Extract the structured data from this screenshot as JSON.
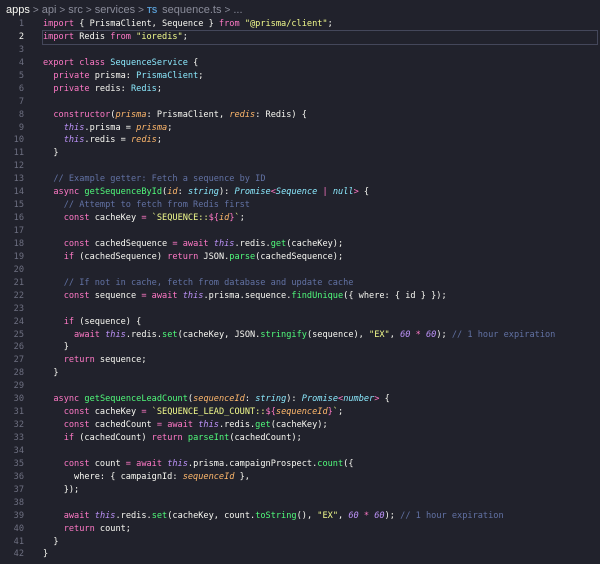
{
  "breadcrumb": {
    "items": [
      "apps",
      "api",
      "src",
      "services"
    ],
    "file_badge": "TS",
    "file": "sequence.ts",
    "more": "..."
  },
  "editor": {
    "active_line": 2,
    "lines": [
      [
        [
          "k",
          "import"
        ],
        [
          "x",
          " { PrismaClient, Sequence } "
        ],
        [
          "k",
          "from"
        ],
        [
          "x",
          " "
        ],
        [
          "s",
          "\"@prisma/client\""
        ],
        [
          "x",
          ";"
        ]
      ],
      [
        [
          "k",
          "import"
        ],
        [
          "x",
          " Redis "
        ],
        [
          "k",
          "from"
        ],
        [
          "x",
          " "
        ],
        [
          "s",
          "\"ioredis\""
        ],
        [
          "x",
          ";"
        ]
      ],
      [],
      [
        [
          "k",
          "export class"
        ],
        [
          "x",
          " "
        ],
        [
          "t",
          "SequenceService"
        ],
        [
          "x",
          " {"
        ]
      ],
      [
        [
          "x",
          "  "
        ],
        [
          "k",
          "private"
        ],
        [
          "x",
          " prisma: "
        ],
        [
          "t",
          "PrismaClient"
        ],
        [
          "x",
          ";"
        ]
      ],
      [
        [
          "x",
          "  "
        ],
        [
          "k",
          "private"
        ],
        [
          "x",
          " redis: "
        ],
        [
          "t",
          "Redis"
        ],
        [
          "x",
          ";"
        ]
      ],
      [],
      [
        [
          "x",
          "  "
        ],
        [
          "k",
          "constructor"
        ],
        [
          "x",
          "("
        ],
        [
          "p",
          "prisma"
        ],
        [
          "x",
          ": PrismaClient, "
        ],
        [
          "p",
          "redis"
        ],
        [
          "x",
          ": Redis) {"
        ]
      ],
      [
        [
          "x",
          "    "
        ],
        [
          "th",
          "this"
        ],
        [
          "x",
          ".prisma = "
        ],
        [
          "p",
          "prisma"
        ],
        [
          "x",
          ";"
        ]
      ],
      [
        [
          "x",
          "    "
        ],
        [
          "th",
          "this"
        ],
        [
          "x",
          ".redis = "
        ],
        [
          "p",
          "redis"
        ],
        [
          "x",
          ";"
        ]
      ],
      [
        [
          "x",
          "  }"
        ]
      ],
      [],
      [
        [
          "x",
          "  "
        ],
        [
          "c",
          "// Example getter: Fetch a sequence by ID"
        ]
      ],
      [
        [
          "x",
          "  "
        ],
        [
          "k",
          "async"
        ],
        [
          "x",
          " "
        ],
        [
          "f",
          "getSequenceById"
        ],
        [
          "x",
          "("
        ],
        [
          "p",
          "id"
        ],
        [
          "x",
          ": "
        ],
        [
          "ti",
          "string"
        ],
        [
          "x",
          "): "
        ],
        [
          "ti",
          "Promise"
        ],
        [
          "k",
          "<"
        ],
        [
          "ti",
          "Sequence"
        ],
        [
          "k",
          " | "
        ],
        [
          "ti",
          "null"
        ],
        [
          "k",
          ">"
        ],
        [
          "x",
          " {"
        ]
      ],
      [
        [
          "x",
          "    "
        ],
        [
          "c",
          "// Attempt to fetch from Redis first"
        ]
      ],
      [
        [
          "x",
          "    "
        ],
        [
          "k",
          "const"
        ],
        [
          "x",
          " cacheKey "
        ],
        [
          "k",
          "="
        ],
        [
          "x",
          " "
        ],
        [
          "s",
          "`SEQUENCE::"
        ],
        [
          "k",
          "${"
        ],
        [
          "p",
          "id"
        ],
        [
          "k",
          "}"
        ],
        [
          "s",
          "`"
        ],
        [
          "x",
          ";"
        ]
      ],
      [],
      [
        [
          "x",
          "    "
        ],
        [
          "k",
          "const"
        ],
        [
          "x",
          " cachedSequence "
        ],
        [
          "k",
          "= await"
        ],
        [
          "x",
          " "
        ],
        [
          "th",
          "this"
        ],
        [
          "x",
          ".redis."
        ],
        [
          "f",
          "get"
        ],
        [
          "x",
          "(cacheKey);"
        ]
      ],
      [
        [
          "x",
          "    "
        ],
        [
          "k",
          "if"
        ],
        [
          "x",
          " (cachedSequence) "
        ],
        [
          "k",
          "return"
        ],
        [
          "x",
          " JSON."
        ],
        [
          "f",
          "parse"
        ],
        [
          "x",
          "(cachedSequence);"
        ]
      ],
      [],
      [
        [
          "x",
          "    "
        ],
        [
          "c",
          "// If not in cache, fetch from database and update cache"
        ]
      ],
      [
        [
          "x",
          "    "
        ],
        [
          "k",
          "const"
        ],
        [
          "x",
          " sequence "
        ],
        [
          "k",
          "= await"
        ],
        [
          "x",
          " "
        ],
        [
          "th",
          "this"
        ],
        [
          "x",
          ".prisma.sequence."
        ],
        [
          "f",
          "findUnique"
        ],
        [
          "x",
          "({ where: { id } });"
        ]
      ],
      [],
      [
        [
          "x",
          "    "
        ],
        [
          "k",
          "if"
        ],
        [
          "x",
          " (sequence) {"
        ]
      ],
      [
        [
          "x",
          "      "
        ],
        [
          "k",
          "await"
        ],
        [
          "x",
          " "
        ],
        [
          "th",
          "this"
        ],
        [
          "x",
          ".redis."
        ],
        [
          "f",
          "set"
        ],
        [
          "x",
          "(cacheKey, JSON."
        ],
        [
          "f",
          "stringify"
        ],
        [
          "x",
          "(sequence), "
        ],
        [
          "s",
          "\"EX\""
        ],
        [
          "x",
          ", "
        ],
        [
          "th",
          "60"
        ],
        [
          "k",
          " * "
        ],
        [
          "th",
          "60"
        ],
        [
          "x",
          "); "
        ],
        [
          "c",
          "// 1 hour expiration"
        ]
      ],
      [
        [
          "x",
          "    }"
        ]
      ],
      [
        [
          "x",
          "    "
        ],
        [
          "k",
          "return"
        ],
        [
          "x",
          " sequence;"
        ]
      ],
      [
        [
          "x",
          "  }"
        ]
      ],
      [],
      [
        [
          "x",
          "  "
        ],
        [
          "k",
          "async"
        ],
        [
          "x",
          " "
        ],
        [
          "f",
          "getSequenceLeadCount"
        ],
        [
          "x",
          "("
        ],
        [
          "p",
          "sequenceId"
        ],
        [
          "x",
          ": "
        ],
        [
          "ti",
          "string"
        ],
        [
          "x",
          "): "
        ],
        [
          "ti",
          "Promise"
        ],
        [
          "k",
          "<"
        ],
        [
          "ti",
          "number"
        ],
        [
          "k",
          ">"
        ],
        [
          "x",
          " {"
        ]
      ],
      [
        [
          "x",
          "    "
        ],
        [
          "k",
          "const"
        ],
        [
          "x",
          " cacheKey "
        ],
        [
          "k",
          "="
        ],
        [
          "x",
          " "
        ],
        [
          "s",
          "`SEQUENCE_LEAD_COUNT::"
        ],
        [
          "k",
          "${"
        ],
        [
          "p",
          "sequenceId"
        ],
        [
          "k",
          "}"
        ],
        [
          "s",
          "`"
        ],
        [
          "x",
          ";"
        ]
      ],
      [
        [
          "x",
          "    "
        ],
        [
          "k",
          "const"
        ],
        [
          "x",
          " cachedCount "
        ],
        [
          "k",
          "= await"
        ],
        [
          "x",
          " "
        ],
        [
          "th",
          "this"
        ],
        [
          "x",
          ".redis."
        ],
        [
          "f",
          "get"
        ],
        [
          "x",
          "(cacheKey);"
        ]
      ],
      [
        [
          "x",
          "    "
        ],
        [
          "k",
          "if"
        ],
        [
          "x",
          " (cachedCount) "
        ],
        [
          "k",
          "return"
        ],
        [
          "x",
          " "
        ],
        [
          "f",
          "parseInt"
        ],
        [
          "x",
          "(cachedCount);"
        ]
      ],
      [],
      [
        [
          "x",
          "    "
        ],
        [
          "k",
          "const"
        ],
        [
          "x",
          " count "
        ],
        [
          "k",
          "= await"
        ],
        [
          "x",
          " "
        ],
        [
          "th",
          "this"
        ],
        [
          "x",
          ".prisma.campaignProspect."
        ],
        [
          "f",
          "count"
        ],
        [
          "x",
          "({"
        ]
      ],
      [
        [
          "x",
          "      where: { campaignId: "
        ],
        [
          "p",
          "sequenceId"
        ],
        [
          "x",
          " },"
        ]
      ],
      [
        [
          "x",
          "    });"
        ]
      ],
      [],
      [
        [
          "x",
          "    "
        ],
        [
          "k",
          "await"
        ],
        [
          "x",
          " "
        ],
        [
          "th",
          "this"
        ],
        [
          "x",
          ".redis."
        ],
        [
          "f",
          "set"
        ],
        [
          "x",
          "(cacheKey, count."
        ],
        [
          "f",
          "toString"
        ],
        [
          "x",
          "(), "
        ],
        [
          "s",
          "\"EX\""
        ],
        [
          "x",
          ", "
        ],
        [
          "th",
          "60"
        ],
        [
          "k",
          " * "
        ],
        [
          "th",
          "60"
        ],
        [
          "x",
          "); "
        ],
        [
          "c",
          "// 1 hour expiration"
        ]
      ],
      [
        [
          "x",
          "    "
        ],
        [
          "k",
          "return"
        ],
        [
          "x",
          " count;"
        ]
      ],
      [
        [
          "x",
          "  }"
        ]
      ],
      [
        [
          "x",
          "}"
        ]
      ]
    ]
  }
}
